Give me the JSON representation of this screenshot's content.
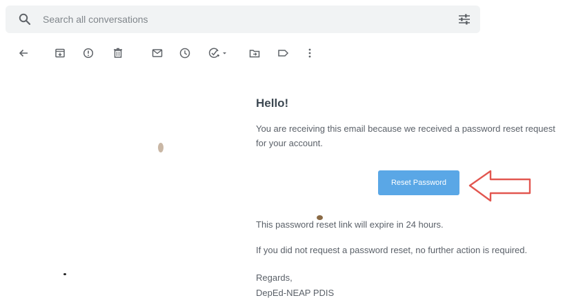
{
  "search": {
    "placeholder": "Search all conversations",
    "icon": "search-icon",
    "options_icon": "tune-icon"
  },
  "toolbar": {
    "icons": [
      "back-arrow-icon",
      "archive-icon",
      "report-spam-icon",
      "delete-icon",
      "mark-unread-icon",
      "snooze-icon",
      "add-to-tasks-icon",
      "move-to-icon",
      "label-icon",
      "more-options-icon"
    ]
  },
  "email": {
    "greeting": "Hello!",
    "intro": "You are receiving this email because we received a password reset request for your account.",
    "button_label": "Reset Password",
    "expiry_note": "This password reset link will expire in 24 hours.",
    "ignore_note": "If you did not request a password reset, no further action is required.",
    "closing": "Regards,",
    "signature": "DepEd-NEAP PDIS"
  },
  "annotation": {
    "arrow_color": "#e2564f",
    "points_to": "reset-password-button"
  },
  "colors": {
    "button": "#5aa7e6",
    "search_bg": "#f1f3f4",
    "icon": "#5f6368"
  }
}
